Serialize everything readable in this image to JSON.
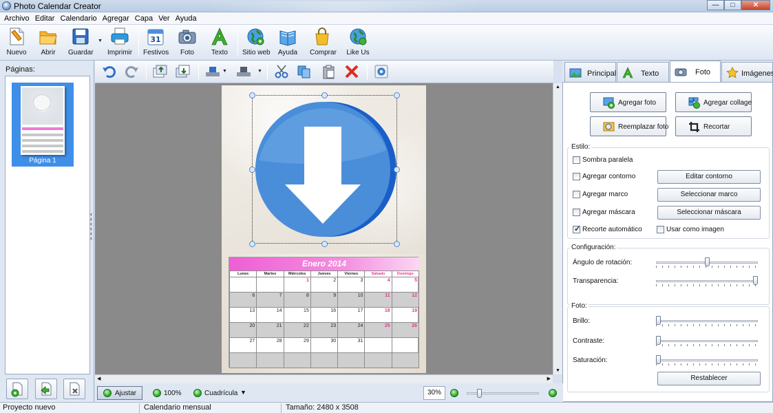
{
  "window": {
    "title": "Photo Calendar Creator",
    "controls": [
      "—",
      "□",
      "✕"
    ]
  },
  "menu": [
    "Archivo",
    "Editar",
    "Calendario",
    "Agregar",
    "Capa",
    "Ver",
    "Ayuda"
  ],
  "toolbar": {
    "nuevo": "Nuevo",
    "abrir": "Abrir",
    "guardar": "Guardar",
    "imprimir": "Imprimir",
    "festivos": "Festivos",
    "foto": "Foto",
    "texto": "Texto",
    "sitio_web": "Sitio web",
    "ayuda": "Ayuda",
    "comprar": "Comprar",
    "like_us": "Like Us"
  },
  "pages": {
    "label": "Páginas:",
    "items": [
      {
        "label": "Página 1"
      }
    ]
  },
  "calendar": {
    "title": "Enero 2014",
    "days": [
      "Lunes",
      "Martes",
      "Miércoles",
      "Jueves",
      "Viernes",
      "Sábado",
      "Domingo"
    ],
    "weeks": [
      [
        "",
        "",
        "1",
        "2",
        "3",
        "4",
        "5"
      ],
      [
        "6",
        "7",
        "8",
        "9",
        "10",
        "11",
        "12"
      ],
      [
        "13",
        "14",
        "15",
        "16",
        "17",
        "18",
        "19"
      ],
      [
        "20",
        "21",
        "22",
        "23",
        "24",
        "25",
        "26"
      ],
      [
        "27",
        "28",
        "29",
        "30",
        "31",
        "",
        ""
      ],
      [
        "",
        "",
        "",
        "",
        "",
        "",
        ""
      ]
    ]
  },
  "right_panel": {
    "tabs": [
      "Principal",
      "Texto",
      "Foto",
      "Imágenes"
    ],
    "active_tab": "Foto",
    "buttons": {
      "agregar_foto": "Agregar foto",
      "agregar_collage": "Agregar collage",
      "reemplazar_foto": "Reemplazar foto",
      "recortar": "Recortar"
    },
    "estilo": {
      "title": "Estilo:",
      "sombra": "Sombra paralela",
      "contorno": "Agregar contorno",
      "contorno_btn": "Editar contorno",
      "marco": "Agregar marco",
      "marco_btn": "Seleccionar marco",
      "mascara": "Agregar máscara",
      "mascara_btn": "Seleccionar máscara",
      "recorte": "Recorte automático",
      "usar_imagen": "Usar como imagen",
      "recorte_checked": true
    },
    "configuracion": {
      "title": "Configuración:",
      "rotacion": "Ángulo de rotación:",
      "rotacion_value": 0.5,
      "transparencia": "Transparencia:",
      "transparencia_value": 1.0
    },
    "foto": {
      "title": "Foto:",
      "brillo": "Brillo:",
      "brillo_value": 0,
      "contraste": "Contraste:",
      "contraste_value": 0,
      "saturacion": "Saturación:",
      "saturacion_value": 0,
      "restablecer": "Restablecer"
    }
  },
  "zoombar": {
    "ajustar": "Ajustar",
    "zoom100": "100%",
    "cuadricula": "Cuadrícula",
    "zoom_value": "30%"
  },
  "status": {
    "project": "Proyecto nuevo",
    "type": "Calendario mensual",
    "size": "Tamaño: 2480 x 3508"
  },
  "colors": {
    "accent": "#3f8fe8",
    "weekend": "#e0388f",
    "calendar_header": "#ee5fd3",
    "photo_blue": "#4a90e2"
  }
}
